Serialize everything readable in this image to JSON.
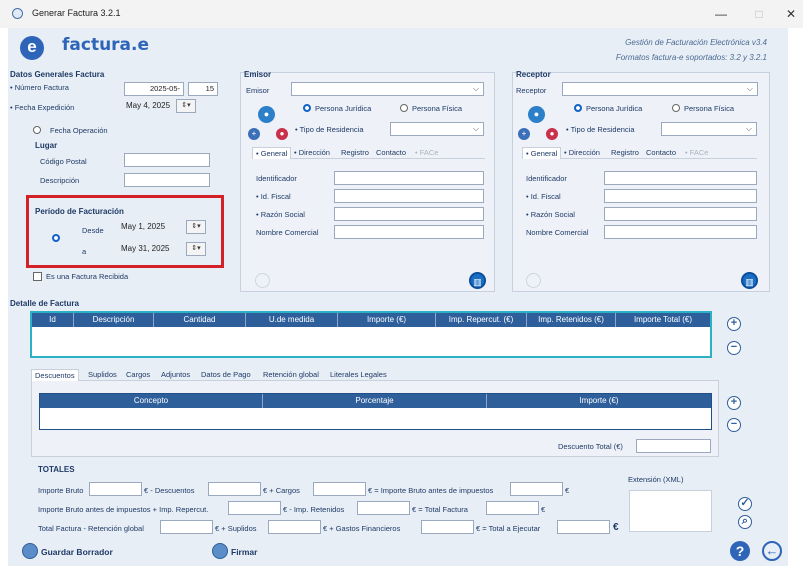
{
  "window": {
    "title": "Generar Factura 3.2.1",
    "minimize": "—",
    "maximize": "□",
    "close": "✕"
  },
  "brand": {
    "logo_letter": "e",
    "name": "factura.e",
    "line1": "Gestión de Facturación Electrónica v3.4",
    "line2": "Formatos factura-e soportados: 3.2 y 3.2.1"
  },
  "general": {
    "title": "Datos Generales Factura",
    "numero_label": "• Número Factura",
    "numero_value": "2025-05-",
    "numero_value2": "15",
    "fecha_exp_label": "• Fecha Expedición",
    "fecha_exp_value": "May 4, 2025",
    "fecha_op_label": "Fecha Operación",
    "lugar_title": "Lugar",
    "cp_label": "Código Postal",
    "desc_label": "Descripción",
    "periodo_title": "Período de Facturación",
    "desde_label": "Desde",
    "desde_value": "May 1, 2025",
    "a_label": "a",
    "a_value": "May 31, 2025",
    "recibida_label": "Es una Factura Recibida"
  },
  "emisor": {
    "title": "Emisor",
    "label": "Emisor",
    "juridica": "Persona Jurídica",
    "fisica": "Persona Física",
    "residencia": "• Tipo de Residencia",
    "tabs": [
      "• General",
      "• Dirección",
      "Registro",
      "Contacto",
      "• FACe"
    ],
    "f_identificador": "Identificador",
    "f_idfiscal": "• Id. Fiscal",
    "f_razon": "• Razón Social",
    "f_comercial": "Nombre Comercial"
  },
  "receptor": {
    "title": "Receptor",
    "label": "Receptor",
    "juridica": "Persona Jurídica",
    "fisica": "Persona Física",
    "residencia": "• Tipo de Residencia",
    "tabs": [
      "• General",
      "• Dirección",
      "Registro",
      "Contacto",
      "• FACe"
    ],
    "f_identificador": "Identificador",
    "f_idfiscal": "• Id. Fiscal",
    "f_razon": "• Razón Social",
    "f_comercial": "Nombre Comercial"
  },
  "detalle": {
    "title": "Detalle de Factura",
    "columns": [
      "Id",
      "Descripción",
      "Cantidad",
      "U.de medida",
      "Importe (€)",
      "Imp. Repercut. (€)",
      "Imp. Retenidos (€)",
      "Importe Total (€)"
    ]
  },
  "subtabs": [
    "Descuentos",
    "Suplidos",
    "Cargos",
    "Adjuntos",
    "Datos de Pago",
    "Retención global",
    "Literales Legales"
  ],
  "descuentos": {
    "columns": [
      "Concepto",
      "Porcentaje",
      "Importe (€)"
    ],
    "total_label": "Descuento Total (€)"
  },
  "totales": {
    "title": "TOTALES",
    "r1": [
      "Importe Bruto",
      "€ - Descuentos",
      "€ + Cargos",
      "€ = Importe Bruto antes de impuestos",
      "€"
    ],
    "r2": [
      "Importe Bruto antes de impuestos + Imp. Repercut.",
      "€ - Imp. Retenidos",
      "€ = Total Factura",
      "€"
    ],
    "r3": [
      "Total Factura - Retención global",
      "€ + Suplidos",
      "€ + Gastos Financieros",
      "€ = Total a Ejecutar",
      "€"
    ],
    "extension_label": "Extensión (XML)"
  },
  "footer": {
    "guardar": "Guardar Borrador",
    "firmar": "Firmar",
    "help": "?",
    "back": "←"
  },
  "colors": {
    "accent": "#2e65b8",
    "highlight": "#d42027",
    "panel": "#e8eef6"
  }
}
